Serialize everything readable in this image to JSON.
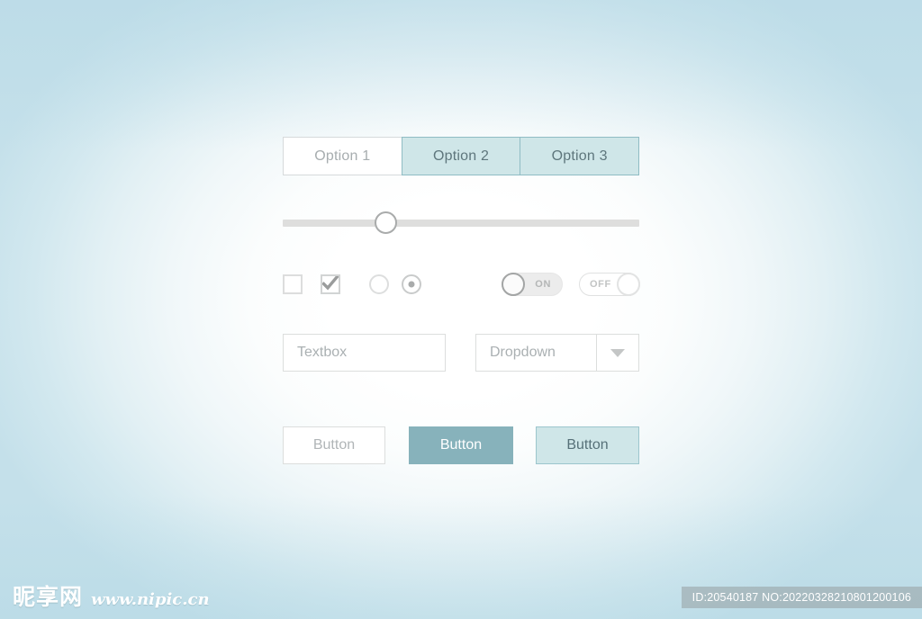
{
  "page": {
    "background_center_color": "#ffffff",
    "background_edge_color": "#bfdfe8"
  },
  "segmented_control": {
    "options": [
      {
        "label": "Option 1",
        "active": false
      },
      {
        "label": "Option 2",
        "active": true
      },
      {
        "label": "Option 3",
        "active": true
      }
    ],
    "inactive_bg": "#ffffff",
    "active_bg": "#cfe6e8",
    "active_border": "#8fbcc4",
    "inactive_text": "#a7adaf",
    "active_text": "#5e767c"
  },
  "slider": {
    "value_percent": 29,
    "track_color": "#dededd",
    "knob_fill": "#ffffff",
    "knob_border": "#a9abab"
  },
  "controls": {
    "checkbox_unchecked": {
      "name": "Checkbox",
      "checked": false
    },
    "checkbox_checked": {
      "name": "Checkbox",
      "checked": true
    },
    "radio_unchecked": {
      "name": "Radio",
      "selected": false
    },
    "radio_selected": {
      "name": "Radio",
      "selected": true
    },
    "toggle_on": {
      "label": "ON",
      "state": "on"
    },
    "toggle_off": {
      "label": "OFF",
      "state": "off"
    }
  },
  "inputs": {
    "textbox": {
      "value": "",
      "placeholder": "Textbox"
    },
    "dropdown": {
      "selected": "Dropdown",
      "arrow_icon": "chevron-down-icon"
    }
  },
  "buttons": [
    {
      "label": "Button",
      "variant": "outline",
      "bg": "#ffffff",
      "text": "#b0b5b7"
    },
    {
      "label": "Button",
      "variant": "primary",
      "bg": "#87b2bb",
      "text": "#ffffff"
    },
    {
      "label": "Button",
      "variant": "soft",
      "bg": "#cfe6e8",
      "text": "#567078"
    }
  ],
  "watermark": {
    "logo": "昵享网",
    "url": "www.nipic.cn"
  },
  "id_bar": {
    "text": "ID:20540187 NO:20220328210801200106"
  }
}
